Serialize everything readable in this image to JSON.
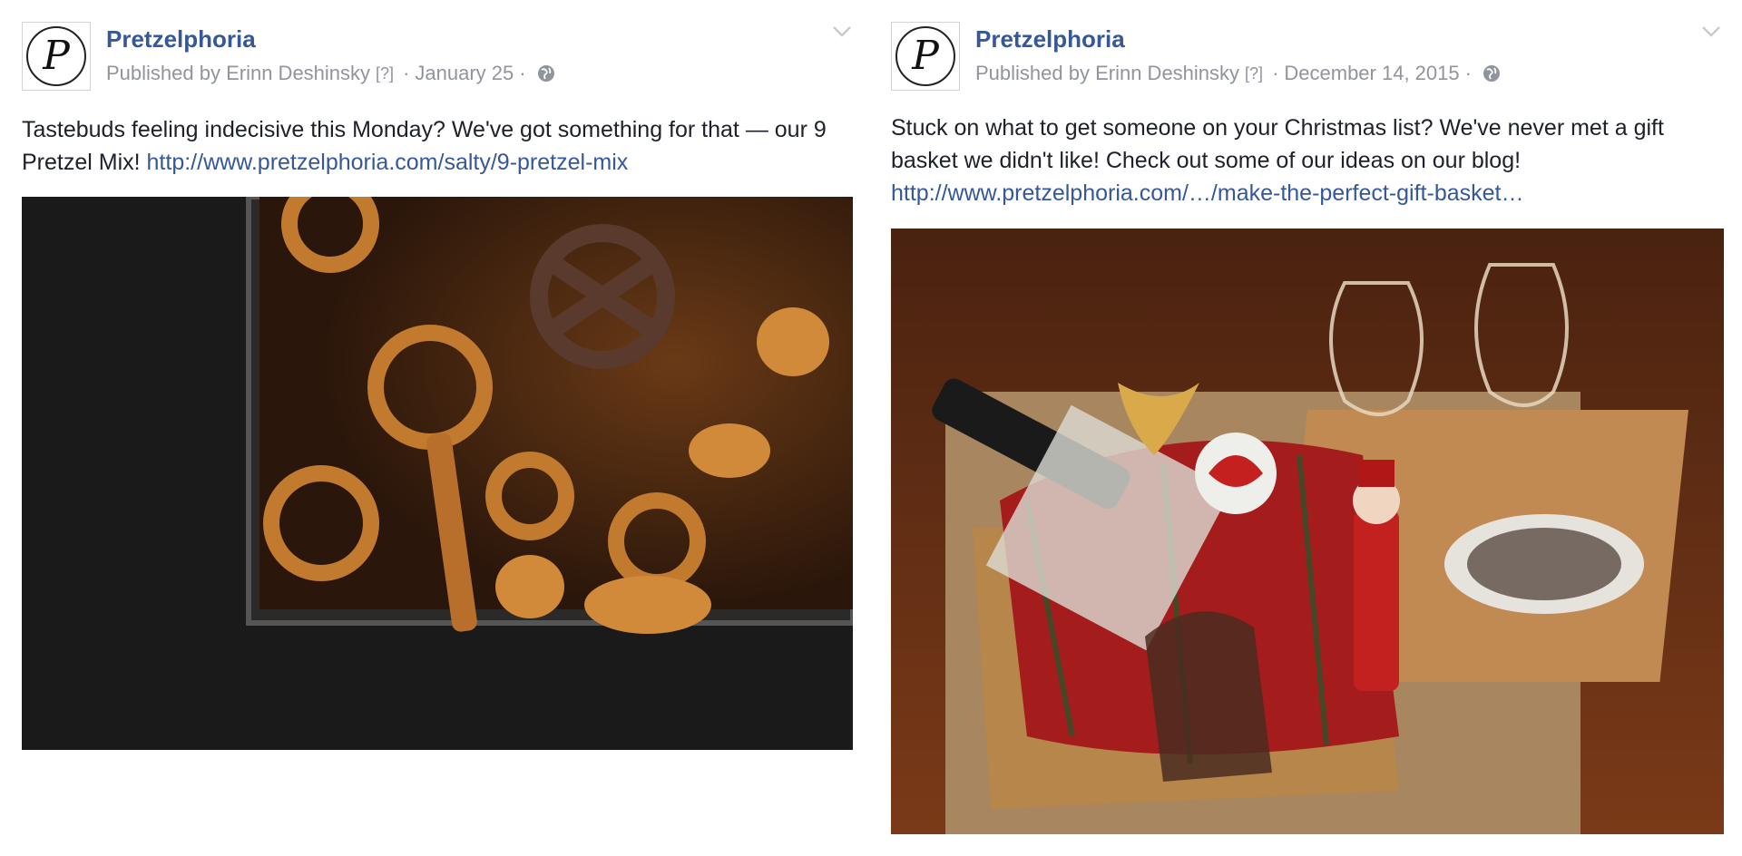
{
  "posts": [
    {
      "page_name": "Pretzelphoria",
      "published_by": "Published by Erinn Deshinsky",
      "help_marker": "[?]",
      "separator": "·",
      "date": "January 25",
      "text_before_link": "Tastebuds feeling indecisive this Monday? We've got something for that — our 9 Pretzel Mix! ",
      "link": "http://www.pretzelphoria.com/salty/9-pretzel-mix",
      "image": "Pretzel mix in a glass dish on a dark background"
    },
    {
      "page_name": "Pretzelphoria",
      "published_by": "Published by Erinn Deshinsky",
      "help_marker": "[?]",
      "separator": "·",
      "date": "December 14, 2015",
      "text_before_link": "Stuck on what to get someone on your Christmas list? We've never met a gift basket we didn't like! Check out some of our ideas on our blog! ",
      "link": "http://www.pretzelphoria.com/…/make-the-perfect-gift-basket…",
      "image": "Holiday gift basket with wine, nutcracker and wine glasses"
    }
  ],
  "colors": {
    "link": "#365899",
    "meta": "#90949c",
    "text": "#1d2129"
  },
  "icons": {
    "avatar": "pretzelphoria-logo-icon",
    "privacy": "globe-icon",
    "menu": "chevron-down-icon"
  }
}
